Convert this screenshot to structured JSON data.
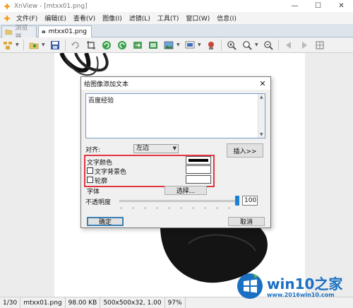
{
  "window": {
    "title": "XnView - [mtxx01.png]",
    "controls": {
      "minimize": "—",
      "maximize": "☐",
      "close": "✕"
    }
  },
  "menubar": {
    "items": [
      "文件(F)",
      "编辑(E)",
      "查看(V)",
      "图像(I)",
      "滤镜(L)",
      "工具(T)",
      "窗口(W)",
      "信息(I)"
    ]
  },
  "tabs": [
    {
      "label": "浏览器",
      "active": false,
      "icon": "folder-icon"
    },
    {
      "label": "mtxx01.png",
      "active": true,
      "icon": "camera-icon"
    }
  ],
  "toolbar": {
    "icons": [
      "browser-icon",
      "open-folder-icon",
      "save-icon",
      "undo-icon",
      "crop-icon",
      "rotate-left-icon",
      "rotate-right-icon",
      "refresh-icon",
      "export-icon",
      "image-icon",
      "slideshow-icon",
      "stamp-icon",
      "zoom-in-icon",
      "zoom-icon",
      "zoom-out-icon",
      "prev-icon",
      "next-icon",
      "fit-icon"
    ]
  },
  "dialog": {
    "title": "给图像添加文本",
    "text_value": "百度经验",
    "align_label": "对齐:",
    "align_value": "左边",
    "insert_button": "插入>>",
    "text_color_label": "文字颜色",
    "bg_color_label": "文字背景色",
    "outline_label": "轮廓",
    "font_label": "字体",
    "choose_button": "选择...",
    "opacity_label": "不透明度",
    "opacity_value": "100",
    "ok_button": "确定",
    "cancel_button": "取消"
  },
  "statusbar": {
    "page": "1/30",
    "filename": "mtxx01.png",
    "filesize": "98.00 KB",
    "dimensions": "500x500x32, 1.00",
    "zoom": "97%"
  },
  "watermark": {
    "title": "win10之家",
    "url": "www.2016win10.com"
  },
  "colors": {
    "highlight_red": "#e0373f",
    "watermark_blue": "#1a6fc2",
    "slider_blue": "#1e7fd6"
  }
}
